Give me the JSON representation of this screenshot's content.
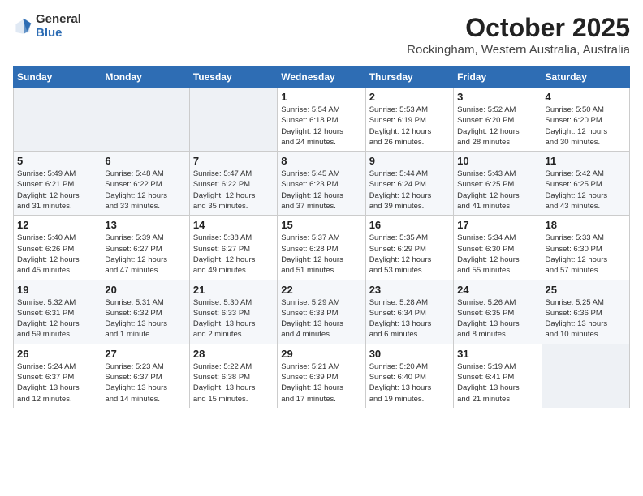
{
  "logo": {
    "general": "General",
    "blue": "Blue"
  },
  "title": "October 2025",
  "location": "Rockingham, Western Australia, Australia",
  "weekdays": [
    "Sunday",
    "Monday",
    "Tuesday",
    "Wednesday",
    "Thursday",
    "Friday",
    "Saturday"
  ],
  "weeks": [
    [
      {
        "day": "",
        "info": ""
      },
      {
        "day": "",
        "info": ""
      },
      {
        "day": "",
        "info": ""
      },
      {
        "day": "1",
        "info": "Sunrise: 5:54 AM\nSunset: 6:18 PM\nDaylight: 12 hours\nand 24 minutes."
      },
      {
        "day": "2",
        "info": "Sunrise: 5:53 AM\nSunset: 6:19 PM\nDaylight: 12 hours\nand 26 minutes."
      },
      {
        "day": "3",
        "info": "Sunrise: 5:52 AM\nSunset: 6:20 PM\nDaylight: 12 hours\nand 28 minutes."
      },
      {
        "day": "4",
        "info": "Sunrise: 5:50 AM\nSunset: 6:20 PM\nDaylight: 12 hours\nand 30 minutes."
      }
    ],
    [
      {
        "day": "5",
        "info": "Sunrise: 5:49 AM\nSunset: 6:21 PM\nDaylight: 12 hours\nand 31 minutes."
      },
      {
        "day": "6",
        "info": "Sunrise: 5:48 AM\nSunset: 6:22 PM\nDaylight: 12 hours\nand 33 minutes."
      },
      {
        "day": "7",
        "info": "Sunrise: 5:47 AM\nSunset: 6:22 PM\nDaylight: 12 hours\nand 35 minutes."
      },
      {
        "day": "8",
        "info": "Sunrise: 5:45 AM\nSunset: 6:23 PM\nDaylight: 12 hours\nand 37 minutes."
      },
      {
        "day": "9",
        "info": "Sunrise: 5:44 AM\nSunset: 6:24 PM\nDaylight: 12 hours\nand 39 minutes."
      },
      {
        "day": "10",
        "info": "Sunrise: 5:43 AM\nSunset: 6:25 PM\nDaylight: 12 hours\nand 41 minutes."
      },
      {
        "day": "11",
        "info": "Sunrise: 5:42 AM\nSunset: 6:25 PM\nDaylight: 12 hours\nand 43 minutes."
      }
    ],
    [
      {
        "day": "12",
        "info": "Sunrise: 5:40 AM\nSunset: 6:26 PM\nDaylight: 12 hours\nand 45 minutes."
      },
      {
        "day": "13",
        "info": "Sunrise: 5:39 AM\nSunset: 6:27 PM\nDaylight: 12 hours\nand 47 minutes."
      },
      {
        "day": "14",
        "info": "Sunrise: 5:38 AM\nSunset: 6:27 PM\nDaylight: 12 hours\nand 49 minutes."
      },
      {
        "day": "15",
        "info": "Sunrise: 5:37 AM\nSunset: 6:28 PM\nDaylight: 12 hours\nand 51 minutes."
      },
      {
        "day": "16",
        "info": "Sunrise: 5:35 AM\nSunset: 6:29 PM\nDaylight: 12 hours\nand 53 minutes."
      },
      {
        "day": "17",
        "info": "Sunrise: 5:34 AM\nSunset: 6:30 PM\nDaylight: 12 hours\nand 55 minutes."
      },
      {
        "day": "18",
        "info": "Sunrise: 5:33 AM\nSunset: 6:30 PM\nDaylight: 12 hours\nand 57 minutes."
      }
    ],
    [
      {
        "day": "19",
        "info": "Sunrise: 5:32 AM\nSunset: 6:31 PM\nDaylight: 12 hours\nand 59 minutes."
      },
      {
        "day": "20",
        "info": "Sunrise: 5:31 AM\nSunset: 6:32 PM\nDaylight: 13 hours\nand 1 minute."
      },
      {
        "day": "21",
        "info": "Sunrise: 5:30 AM\nSunset: 6:33 PM\nDaylight: 13 hours\nand 2 minutes."
      },
      {
        "day": "22",
        "info": "Sunrise: 5:29 AM\nSunset: 6:33 PM\nDaylight: 13 hours\nand 4 minutes."
      },
      {
        "day": "23",
        "info": "Sunrise: 5:28 AM\nSunset: 6:34 PM\nDaylight: 13 hours\nand 6 minutes."
      },
      {
        "day": "24",
        "info": "Sunrise: 5:26 AM\nSunset: 6:35 PM\nDaylight: 13 hours\nand 8 minutes."
      },
      {
        "day": "25",
        "info": "Sunrise: 5:25 AM\nSunset: 6:36 PM\nDaylight: 13 hours\nand 10 minutes."
      }
    ],
    [
      {
        "day": "26",
        "info": "Sunrise: 5:24 AM\nSunset: 6:37 PM\nDaylight: 13 hours\nand 12 minutes."
      },
      {
        "day": "27",
        "info": "Sunrise: 5:23 AM\nSunset: 6:37 PM\nDaylight: 13 hours\nand 14 minutes."
      },
      {
        "day": "28",
        "info": "Sunrise: 5:22 AM\nSunset: 6:38 PM\nDaylight: 13 hours\nand 15 minutes."
      },
      {
        "day": "29",
        "info": "Sunrise: 5:21 AM\nSunset: 6:39 PM\nDaylight: 13 hours\nand 17 minutes."
      },
      {
        "day": "30",
        "info": "Sunrise: 5:20 AM\nSunset: 6:40 PM\nDaylight: 13 hours\nand 19 minutes."
      },
      {
        "day": "31",
        "info": "Sunrise: 5:19 AM\nSunset: 6:41 PM\nDaylight: 13 hours\nand 21 minutes."
      },
      {
        "day": "",
        "info": ""
      }
    ]
  ]
}
